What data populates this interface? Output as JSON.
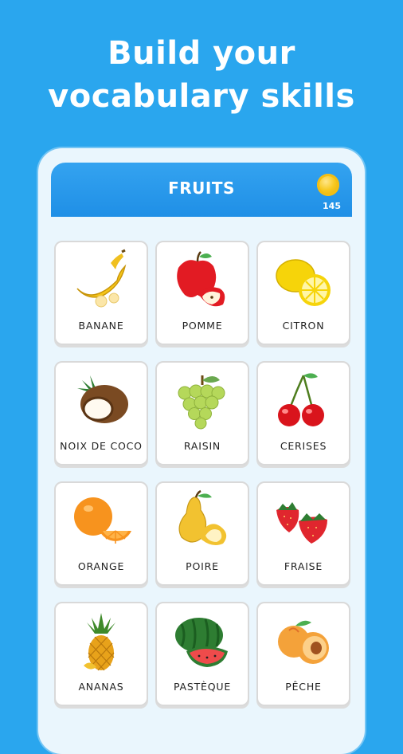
{
  "headline": {
    "line1": "Build your",
    "line2": "vocabulary skills"
  },
  "topbar": {
    "title": "FRUITS",
    "coins": "145"
  },
  "cards": [
    {
      "label": "BANANE"
    },
    {
      "label": "POMME"
    },
    {
      "label": "CITRON"
    },
    {
      "label": "NOIX DE COCO"
    },
    {
      "label": "RAISIN"
    },
    {
      "label": "CERISES"
    },
    {
      "label": "ORANGE"
    },
    {
      "label": "POIRE"
    },
    {
      "label": "FRAISE"
    },
    {
      "label": "ANANAS"
    },
    {
      "label": "PASTÈQUE"
    },
    {
      "label": "PÊCHE"
    }
  ],
  "colors": {
    "background": "#2aa6ee",
    "topbar": "#2196ea",
    "panel": "#eaf6fd",
    "coin": "#f7c81e"
  }
}
